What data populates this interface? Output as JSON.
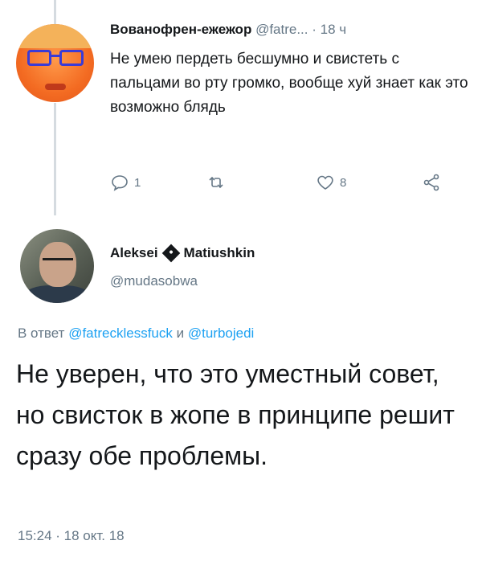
{
  "tweet1": {
    "author_name": "Вованофрен-ежежор",
    "handle": "@fatre...",
    "separator": "·",
    "time": "18 ч",
    "text": "Не умею пердеть бесшумно и свистеть с пальцами во рту громко, вообще хуй знает как это возможно блядь",
    "actions": {
      "reply_count": "1",
      "retweet_count": "",
      "like_count": "8"
    },
    "icons": {
      "reply": "reply-icon",
      "retweet": "retweet-icon",
      "like": "heart-icon",
      "share": "share-icon"
    }
  },
  "tweet2": {
    "first_name": "Aleksei",
    "last_name": "Matiushkin",
    "handle": "@mudasobwa",
    "reply_prefix": "В ответ",
    "reply_user1": "@fatrecklessfuck",
    "reply_and": "и",
    "reply_user2": "@turbojedi",
    "text": "Не уверен, что это уместный совет, но свисток в жопе в принципе решит сразу обе проблемы.",
    "meta": "15:24 · 18 окт. 18"
  },
  "colors": {
    "text": "#14171a",
    "secondary": "#657786",
    "link": "#1da1f2",
    "thread_line": "#d5dbe0"
  }
}
